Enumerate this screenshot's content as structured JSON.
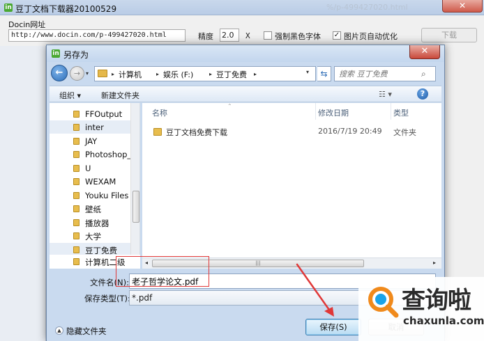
{
  "background_app": {
    "title": "豆丁文档下载器20100529",
    "app_icon": "in",
    "ghost_tab": "%/p-499427020.html",
    "close_label": "✕",
    "url_label": "Docin网址",
    "url_value": "http://www.docin.com/p-499427020.html",
    "precision_label": "精度",
    "precision_value": "2.0",
    "precision_unit": "X",
    "force_black_label": "强制黑色字体",
    "force_black_checked": false,
    "auto_optimize_label": "图片页自动优化",
    "auto_optimize_checked": true,
    "download_label": "下载"
  },
  "dialog": {
    "title": "另存为",
    "app_icon": "in",
    "close_label": "✕",
    "nav": {
      "back_icon": "←",
      "forward_icon": "→",
      "recent_icon": "▾"
    },
    "breadcrumb": [
      "计算机",
      "娱乐 (F:)",
      "豆丁免费"
    ],
    "breadcrumb_separator": "▸",
    "address_dropdown": "▾",
    "refresh_icon": "⇆",
    "search": {
      "placeholder": "搜索 豆丁免费",
      "icon": "⌕"
    },
    "toolbar": {
      "organize": "组织 ▾",
      "new_folder": "新建文件夹",
      "view": "☷ ▾",
      "help": "?"
    },
    "nav_items": [
      {
        "label": "FFOutput",
        "selected": false
      },
      {
        "label": "inter",
        "selected": true
      },
      {
        "label": "JAY",
        "selected": false
      },
      {
        "label": "Photoshop_",
        "selected": false
      },
      {
        "label": "U",
        "selected": false
      },
      {
        "label": "WEXAM",
        "selected": false
      },
      {
        "label": "Youku Files",
        "selected": false
      },
      {
        "label": "壁纸",
        "selected": false
      },
      {
        "label": "播放器",
        "selected": false
      },
      {
        "label": "大学",
        "selected": false
      },
      {
        "label": "豆丁免费",
        "selected": true
      }
    ],
    "nav_cut_item": "计算机二级",
    "columns": {
      "sort_indicator": "⌃",
      "name": "名称",
      "modified": "修改日期",
      "type": "类型"
    },
    "files": [
      {
        "name": "豆丁文档免费下载",
        "modified": "2016/7/19 20:49",
        "type": "文件夹"
      }
    ],
    "hscroll": {
      "left": "◂",
      "right": "▸",
      "grip": "|||"
    },
    "filename_label": "文件名(N):",
    "filename_value": "老子哲学论文.pdf",
    "filetype_label": "保存类型(T):",
    "filetype_value": "*.pdf",
    "hide_folders_icon": "▲",
    "hide_folders_label": "隐藏文件夹",
    "save_label": "保存(S)",
    "cancel_label": "取消"
  },
  "annotation": {
    "color": "#e03838"
  },
  "watermark": {
    "text": "查询啦",
    "domain": "chaxunla.com",
    "colors": [
      "#f08a1c",
      "#1aa3e8"
    ]
  }
}
